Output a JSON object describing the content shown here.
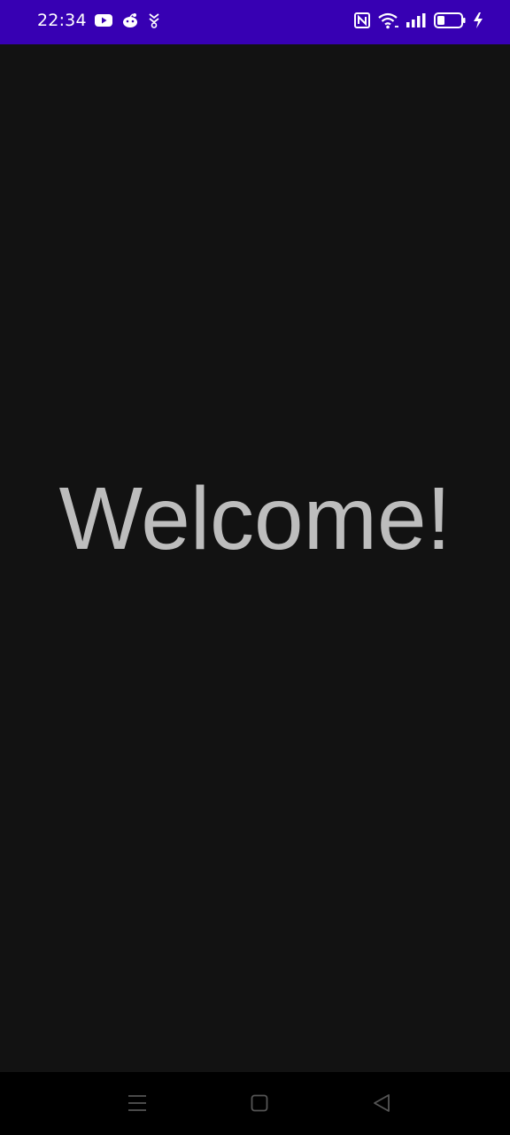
{
  "status_bar": {
    "time": "22:34",
    "background": "#3700b3",
    "left_icons": [
      "youtube-icon",
      "reddit-icon",
      "notification-app-icon"
    ],
    "right_icons": [
      "nfc-icon",
      "wifi-icon",
      "signal-icon",
      "battery-icon",
      "charging-icon"
    ]
  },
  "main": {
    "welcome_text": "Welcome!",
    "background": "#121212",
    "text_color": "#bdbdbd"
  },
  "nav_bar": {
    "buttons": [
      "menu-icon",
      "home-icon",
      "back-icon"
    ]
  }
}
